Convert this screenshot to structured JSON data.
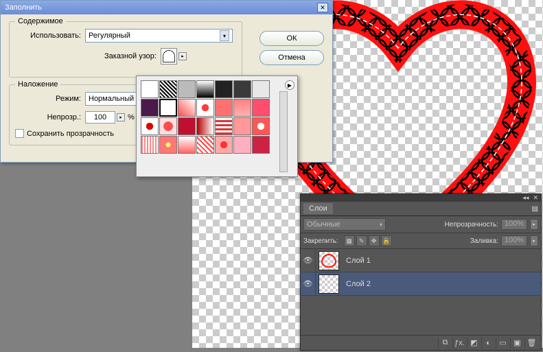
{
  "dialog": {
    "title": "Заполнить",
    "content_legend": "Содержимое",
    "use_label": "Использовать:",
    "use_value": "Регулярный",
    "custom_pattern_label": "Заказной узор:",
    "overlay_legend": "Наложение",
    "mode_label": "Режим:",
    "mode_value": "Нормальный",
    "opacity_label": "Непрозр.:",
    "opacity_value": "100",
    "opacity_suffix": "%",
    "preserve_trans": "Сохранить прозрачность",
    "ok": "ОК",
    "cancel": "Отмена"
  },
  "pattern_popup": {
    "rows": 5,
    "cols": 7,
    "swatches": [
      {
        "bg": "#ffffff"
      },
      {
        "bg": "repeating-linear-gradient(45deg,#000,#000 2px,#fff 2px,#fff 4px)"
      },
      {
        "bg": "#bbbbbb"
      },
      {
        "bg": "linear-gradient(#fff,#000)"
      },
      {
        "bg": "#222222"
      },
      {
        "bg": "#3a3a3a"
      },
      {
        "bg": "#e8e8e8"
      },
      {
        "bg": "#4b1a4b"
      },
      {
        "bg": "#ffffff",
        "sel": true
      },
      {
        "bg": "linear-gradient(45deg,#ff4d4d,#fff)"
      },
      {
        "bg": "radial-gradient(#ff3b3b 30%,#fff 31%)"
      },
      {
        "bg": "#ff7070"
      },
      {
        "bg": "linear-gradient(#ff8080,#ffb0b0)"
      },
      {
        "bg": "#ff4d6d"
      },
      {
        "bg": "radial-gradient(#d00 30%,#fff 31%)"
      },
      {
        "bg": "radial-gradient(#ff4d4d 40%,#ffe0e0 41%)"
      },
      {
        "bg": "#c01030"
      },
      {
        "bg": "linear-gradient(90deg,#b00,#fff)"
      },
      {
        "bg": "repeating-linear-gradient(0deg,#d33,#d33 3px,#fff 3px,#fff 6px)"
      },
      {
        "bg": "#ff9999"
      },
      {
        "bg": "radial-gradient(circle,#fff 30%,#f55 31%)"
      },
      {
        "bg": "repeating-linear-gradient(90deg,#f88,#f88 2px,#fff 2px,#fff 4px)"
      },
      {
        "bg": "radial-gradient(#ff6 20%,#f77 21%)"
      },
      {
        "bg": "linear-gradient(#fff,#f66)"
      },
      {
        "bg": "repeating-linear-gradient(45deg,#f44,#f44 2px,#fff 2px,#fff 5px)"
      },
      {
        "bg": "radial-gradient(#f33 30%,#faa 31%)"
      },
      {
        "bg": "#ffb0c0"
      },
      {
        "bg": "#cc2244"
      }
    ]
  },
  "layers": {
    "tab": "Слои",
    "blend_value": "Обычные",
    "opacity_label": "Непрозрачность:",
    "opacity_value": "100%",
    "lock_label": "Закрепить:",
    "fill_label": "Заливка:",
    "fill_value": "100%",
    "items": [
      {
        "name": "Слой 1",
        "selected": false,
        "heart": true
      },
      {
        "name": "Слой 2",
        "selected": true,
        "heart": false
      }
    ],
    "footer_icons": [
      "⟲",
      "fx.",
      "◩",
      "◐",
      "▭",
      "▣",
      "🗑"
    ]
  }
}
